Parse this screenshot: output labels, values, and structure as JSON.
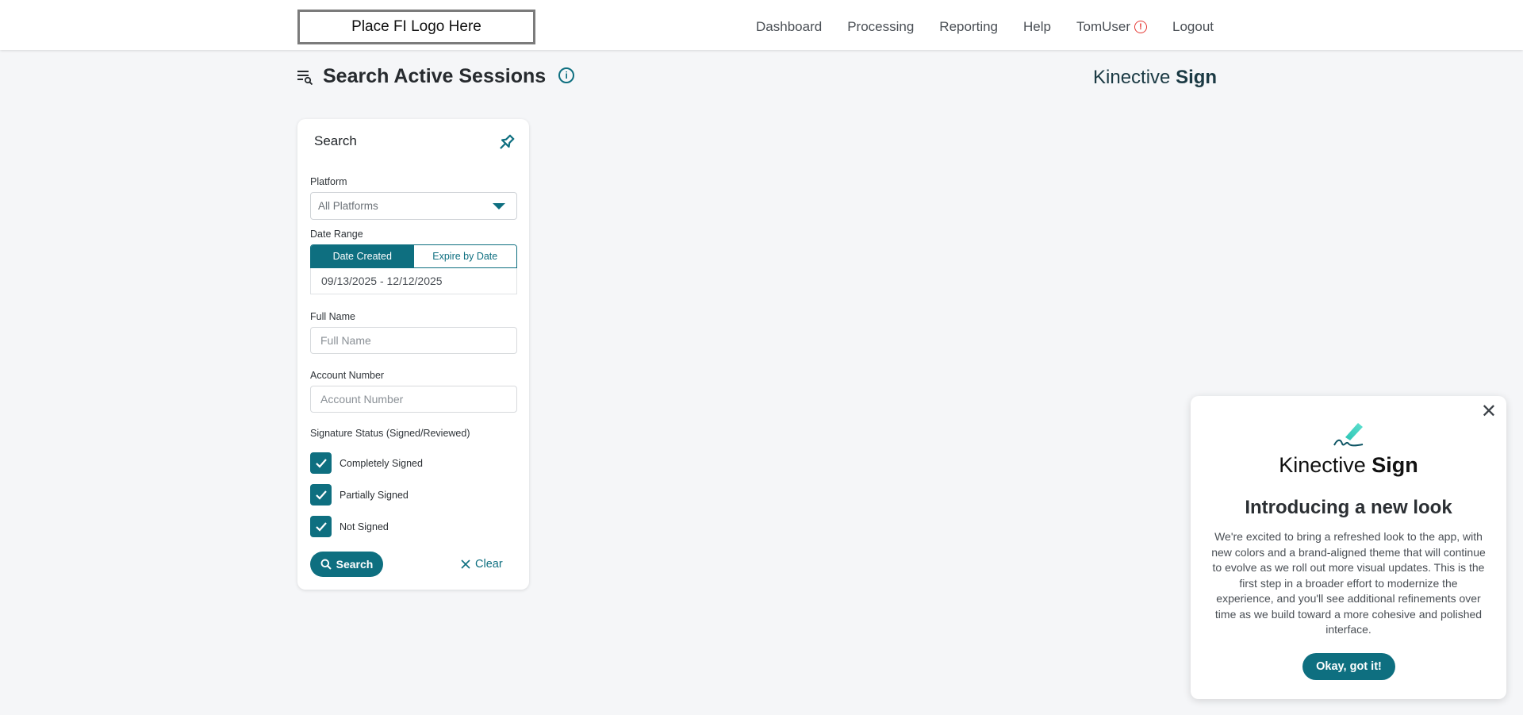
{
  "header": {
    "logo_text": "Place FI Logo Here",
    "nav": {
      "dashboard": "Dashboard",
      "processing": "Processing",
      "reporting": "Reporting",
      "help": "Help",
      "user": "TomUser",
      "user_alert": "!",
      "logout": "Logout"
    }
  },
  "page": {
    "title": "Search Active Sessions",
    "info_glyph": "i",
    "brand_light": "Kinective",
    "brand_bold": "Sign"
  },
  "search_panel": {
    "title": "Search",
    "platform_label": "Platform",
    "platform_value": "All Platforms",
    "date_range_label": "Date Range",
    "date_tabs": {
      "active": "Date Created",
      "inactive": "Expire by Date"
    },
    "date_range_value": "09/13/2025 - 12/12/2025",
    "full_name_label": "Full Name",
    "full_name_placeholder": "Full Name",
    "account_number_label": "Account Number",
    "account_number_placeholder": "Account Number",
    "signature_status_label": "Signature Status (Signed/Reviewed)",
    "checkboxes": [
      {
        "label": "Completely Signed",
        "checked": true
      },
      {
        "label": "Partially Signed",
        "checked": true
      },
      {
        "label": "Not Signed",
        "checked": true
      }
    ],
    "search_button": "Search",
    "clear_button": "Clear"
  },
  "popup": {
    "brand_light": "Kinective",
    "brand_bold": "Sign",
    "heading": "Introducing a new look",
    "body": "We're excited to bring a refreshed look to the app, with new colors and a brand-aligned theme that will continue to evolve as we roll out more visual updates. This is the first step in a broader effort to modernize the experience, and you'll see additional refinements over time as we build toward a more cohesive and polished interface.",
    "button": "Okay, got it!",
    "close_glyph": "✕"
  },
  "colors": {
    "accent": "#0e6f80",
    "alert": "#e53935",
    "background": "#f5f6f8"
  },
  "icons": {
    "title_icon": "search-list-icon",
    "pin": "pin-icon",
    "search": "magnifier-icon",
    "clear": "x-icon",
    "brand": "pen-signature-icon"
  }
}
